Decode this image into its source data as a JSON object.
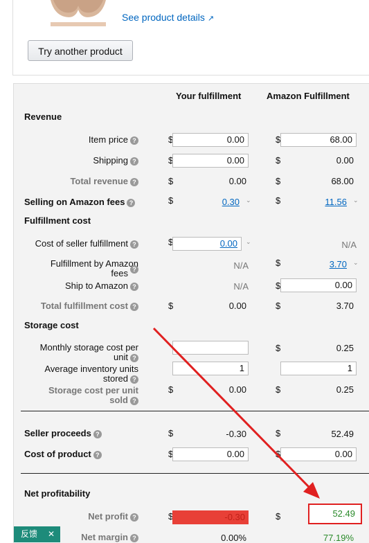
{
  "top": {
    "see_details": "See product details",
    "try_button": "Try another product"
  },
  "headers": {
    "yours": "Your fulfillment",
    "amazon": "Amazon Fulfillment"
  },
  "currency": "$",
  "sections": {
    "revenue": "Revenue",
    "fulfillment_cost": "Fulfillment cost",
    "storage_cost": "Storage cost",
    "net_profitability": "Net profitability"
  },
  "rows": {
    "item_price": {
      "label": "Item price",
      "yours": "0.00",
      "amazon": "68.00"
    },
    "shipping": {
      "label": "Shipping",
      "yours": "0.00",
      "amazon": "0.00"
    },
    "total_revenue": {
      "label": "Total revenue",
      "yours": "0.00",
      "amazon": "68.00"
    },
    "selling_fees": {
      "label": "Selling on Amazon fees",
      "yours": "0.30",
      "amazon": "11.56"
    },
    "seller_fulfillment": {
      "label": "Cost of seller fulfillment",
      "yours": "0.00",
      "amazon": "N/A"
    },
    "fba_fees": {
      "label_line1": "Fulfillment by Amazon",
      "label_line2": "fees",
      "yours": "N/A",
      "amazon": "3.70"
    },
    "ship_to_amazon": {
      "label": "Ship to Amazon",
      "yours": "N/A",
      "amazon": "0.00"
    },
    "total_fulfillment": {
      "label": "Total fulfillment cost",
      "yours": "0.00",
      "amazon": "3.70"
    },
    "monthly_storage": {
      "label_line1": "Monthly storage cost per",
      "label_line2": "unit",
      "yours": "",
      "amazon": "0.25"
    },
    "avg_inventory": {
      "label_line1": "Average inventory units",
      "label_line2": "stored",
      "yours": "1",
      "amazon": "1"
    },
    "storage_per_unit": {
      "label_line1": "Storage cost per unit",
      "label_line2": "sold",
      "yours": "0.00",
      "amazon": "0.25"
    },
    "seller_proceeds": {
      "label": "Seller proceeds",
      "yours": "-0.30",
      "amazon": "52.49"
    },
    "cost_of_product": {
      "label": "Cost of product",
      "yours": "0.00",
      "amazon": "0.00"
    },
    "net_profit": {
      "label": "Net profit",
      "yours": "-0.30",
      "amazon": "52.49"
    },
    "net_margin": {
      "label": "Net margin",
      "yours": "0.00%",
      "amazon": "77.19%"
    }
  },
  "feedback": {
    "label": "反馈",
    "close": "✕"
  },
  "colors": {
    "negative_bg": "#e84037",
    "positive_text": "#2a8a2a",
    "annotation": "#e02020",
    "link": "#0066c0"
  }
}
